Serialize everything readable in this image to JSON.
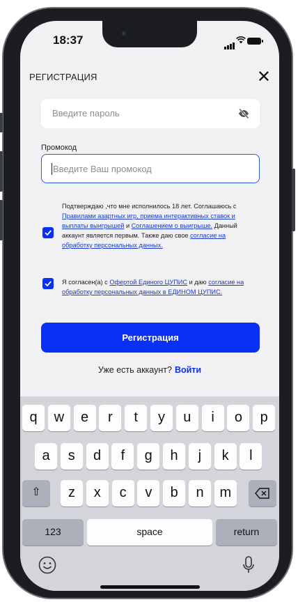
{
  "status": {
    "time": "18:37"
  },
  "header": {
    "title": "РЕГИСТРАЦИЯ",
    "close": "✕"
  },
  "form": {
    "password_placeholder": "Введите пароль",
    "promo_label": "Промокод",
    "promo_placeholder": "Введите Ваш промокод",
    "agree1": {
      "checked": true,
      "t1": "Подтверждаю ,что мне исполнилось 18 лет. Соглашаюсь с ",
      "l1": "Правилами азартных игр, приема интерактивных ставок и выплаты выигрышей",
      "t2": " и ",
      "l2": "Соглашением о выигрыше.",
      "t3": " Данный аккаунт является первым. Также даю свое ",
      "l3": "согласие на обработку персональных данных."
    },
    "agree2": {
      "checked": true,
      "t1": "Я согласен(а) с ",
      "l1": "Офертой Единого ЦУПИС",
      "t2": " и даю ",
      "l2": "согласие на обработку персональных данных в ЕДИНОМ ЦУПИС."
    },
    "register_label": "Регистрация",
    "have_account": "Уже есть аккаунт?",
    "login_label": "Войти"
  },
  "keyboard": {
    "row1": [
      "q",
      "w",
      "e",
      "r",
      "t",
      "y",
      "u",
      "i",
      "o",
      "p"
    ],
    "row2": [
      "a",
      "s",
      "d",
      "f",
      "g",
      "h",
      "j",
      "k",
      "l"
    ],
    "row3": [
      "z",
      "x",
      "c",
      "v",
      "b",
      "n",
      "m"
    ],
    "shift": "⇧",
    "numbers": "123",
    "space": "space",
    "return": "return",
    "icons": [
      "shift-icon",
      "backspace-icon",
      "emoji-icon",
      "microphone-icon"
    ]
  },
  "colors": {
    "accent": "#0a2ff5",
    "link": "#1a3cc7",
    "background": "#f1f1f3",
    "keyboard": "#d3d5da"
  }
}
